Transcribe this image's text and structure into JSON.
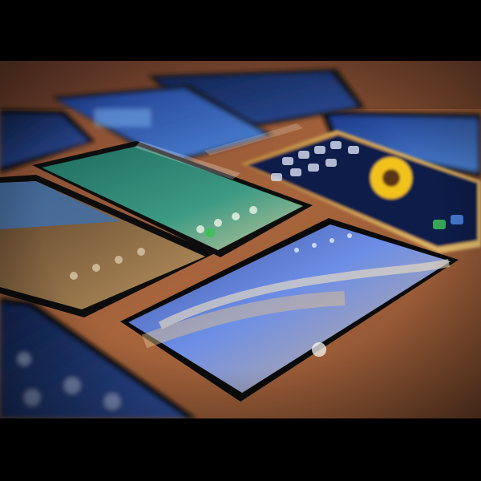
{
  "scene": {
    "subject": "smartphones",
    "count": 8,
    "surface_color": "#9a5a36",
    "background_color": "#000000"
  }
}
